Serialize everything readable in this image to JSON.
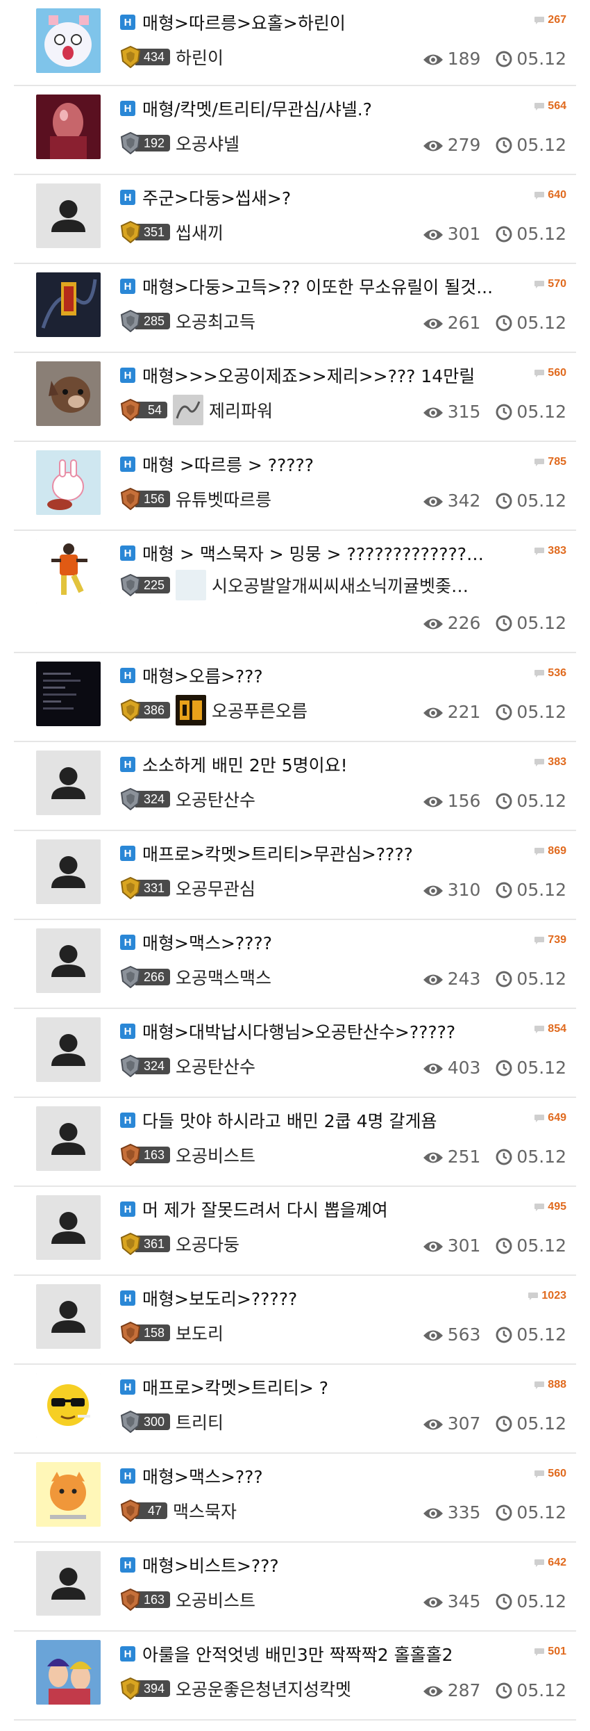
{
  "colors": {
    "h_badge": "#2a87d6",
    "comment_count": "#e06a1e",
    "divider": "#e6e6e6",
    "stat_text": "#666666"
  },
  "icons": {
    "board_badge": "H",
    "comment_icon": "comment-bubble-icon",
    "views_icon": "eye-icon",
    "date_icon": "clock-icon",
    "default_avatar": "person-silhouette-icon"
  },
  "posts": [
    {
      "title": "매형>따르릉>요홀>하린이",
      "comments": "267",
      "level": "434",
      "level_tier": "gold",
      "nickname": "하린이",
      "views": "189",
      "date": "05.12",
      "thumb": "cartoon-cat",
      "mini": null
    },
    {
      "title": "매형/칵멧/트리티/무관심/샤넬.?",
      "comments": "564",
      "level": "192",
      "level_tier": "silver",
      "nickname": "오공샤넬",
      "views": "279",
      "date": "05.12",
      "thumb": "photo-red",
      "mini": null
    },
    {
      "title": "주군>다둥>씹새>?",
      "comments": "640",
      "level": "351",
      "level_tier": "gold",
      "nickname": "씹새끼",
      "views": "301",
      "date": "05.12",
      "thumb": "default",
      "mini": null
    },
    {
      "title": "매형>다둥>고득>?? 이또한 무소유릴이 될것...",
      "comments": "570",
      "level": "285",
      "level_tier": "silver",
      "nickname": "오공최고득",
      "views": "261",
      "date": "05.12",
      "thumb": "dark-gold",
      "mini": null
    },
    {
      "title": "매형>>>오공이제죠>>제리>>??? 14만릴",
      "comments": "560",
      "level": "54",
      "level_tier": "bronze",
      "nickname": "제리파워",
      "views": "315",
      "date": "05.12",
      "thumb": "dog",
      "mini": "sketch"
    },
    {
      "title": "매형 >따르릉 > ?????",
      "comments": "785",
      "level": "156",
      "level_tier": "bronze",
      "nickname": "유튜벳따르릉",
      "views": "342",
      "date": "05.12",
      "thumb": "bunny",
      "mini": null
    },
    {
      "title": "매형 > 맥스묵자 > 밍뭉 > ?????????????…",
      "comments": "383",
      "level": "225",
      "level_tier": "silver",
      "nickname": "시오공발알개씨씨새소닉끼귤벳좆…",
      "views": "226",
      "date": "05.12",
      "thumb": "soccer",
      "mini": "blank",
      "tall": true
    },
    {
      "title": "매형>오름>???",
      "comments": "536",
      "level": "386",
      "level_tier": "gold",
      "nickname": "오공푸른오름",
      "views": "221",
      "date": "05.12",
      "thumb": "dark-screen",
      "mini": "gold-text"
    },
    {
      "title": "소소하게 배민 2만 5명이요!",
      "comments": "383",
      "level": "324",
      "level_tier": "silver",
      "nickname": "오공탄산수",
      "views": "156",
      "date": "05.12",
      "thumb": "default",
      "mini": null
    },
    {
      "title": "매프로>칵멧>트리티>무관심>????",
      "comments": "869",
      "level": "331",
      "level_tier": "gold",
      "nickname": "오공무관심",
      "views": "310",
      "date": "05.12",
      "thumb": "default",
      "mini": null
    },
    {
      "title": "매형>맥스>????",
      "comments": "739",
      "level": "266",
      "level_tier": "silver",
      "nickname": "오공맥스맥스",
      "views": "243",
      "date": "05.12",
      "thumb": "default",
      "mini": null
    },
    {
      "title": "매형>대박납시다행님>오공탄산수>?????",
      "comments": "854",
      "level": "324",
      "level_tier": "silver",
      "nickname": "오공탄산수",
      "views": "403",
      "date": "05.12",
      "thumb": "default",
      "mini": null
    },
    {
      "title": "다들 맛야 하시라고 배민 2쿱 4명 갈게욤",
      "comments": "649",
      "level": "163",
      "level_tier": "bronze",
      "nickname": "오공비스트",
      "views": "251",
      "date": "05.12",
      "thumb": "default",
      "mini": null
    },
    {
      "title": "머 제가 잘못드려서 다시 뽑을꼐여",
      "comments": "495",
      "level": "361",
      "level_tier": "gold",
      "nickname": "오공다둥",
      "views": "301",
      "date": "05.12",
      "thumb": "default",
      "mini": null
    },
    {
      "title": "매형>보도리>?????",
      "comments": "1023",
      "level": "158",
      "level_tier": "bronze",
      "nickname": "보도리",
      "views": "563",
      "date": "05.12",
      "thumb": "default",
      "mini": null
    },
    {
      "title": "매프로>칵멧>트리티> ?",
      "comments": "888",
      "level": "300",
      "level_tier": "silver",
      "nickname": "트리티",
      "views": "307",
      "date": "05.12",
      "thumb": "sunglasses-emoji",
      "mini": null
    },
    {
      "title": "매형>맥스>???",
      "comments": "560",
      "level": "47",
      "level_tier": "bronze",
      "nickname": "맥스묵자",
      "views": "335",
      "date": "05.12",
      "thumb": "cat-cartoon",
      "mini": null
    },
    {
      "title": "매형>비스트>???",
      "comments": "642",
      "level": "163",
      "level_tier": "bronze",
      "nickname": "오공비스트",
      "views": "345",
      "date": "05.12",
      "thumb": "default",
      "mini": null
    },
    {
      "title": "아룰을 안적엇넹 배민3만 짝짝짝2 홀홀홀2",
      "comments": "501",
      "level": "394",
      "level_tier": "gold",
      "nickname": "오공운좋은청년지성칵멧",
      "views": "287",
      "date": "05.12",
      "thumb": "anime",
      "mini": null
    }
  ]
}
